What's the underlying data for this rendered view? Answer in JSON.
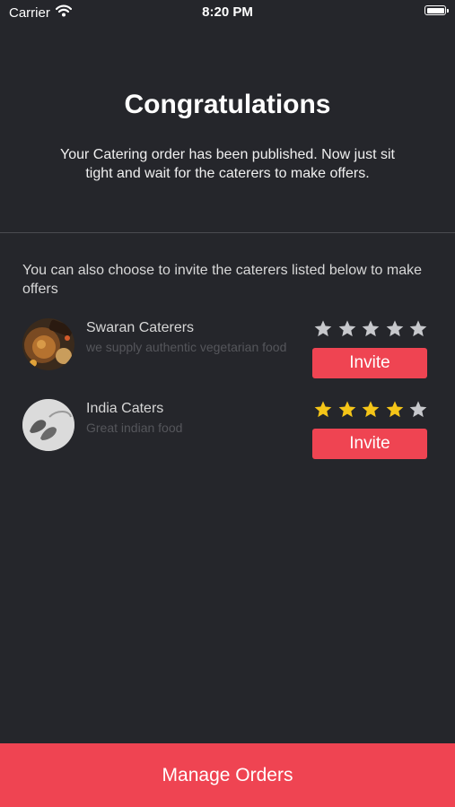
{
  "status_bar": {
    "carrier": "Carrier",
    "time": "8:20 PM",
    "wifi_icon": "wifi-icon",
    "battery_icon": "battery-icon"
  },
  "header": {
    "title": "Congratulations",
    "subtitle": "Your Catering order has been published. Now just sit tight and wait for the caterers to make offers."
  },
  "invite_section": {
    "prompt": "You can also choose to invite the caterers listed below to make offers"
  },
  "caterers": [
    {
      "name": "Swaran Caterers",
      "description": "we supply authentic vegetarian food",
      "rating": 0,
      "max_rating": 5,
      "invite_label": "Invite",
      "avatar_icon": "food-plate-avatar"
    },
    {
      "name": "India Caters",
      "description": "Great indian food",
      "rating": 4,
      "max_rating": 5,
      "invite_label": "Invite",
      "avatar_icon": "logo-avatar"
    }
  ],
  "footer": {
    "manage_label": "Manage Orders"
  },
  "colors": {
    "background": "#25262b",
    "accent": "#ef4452",
    "star_filled": "#f5c518",
    "star_empty": "#c7c8cc"
  }
}
